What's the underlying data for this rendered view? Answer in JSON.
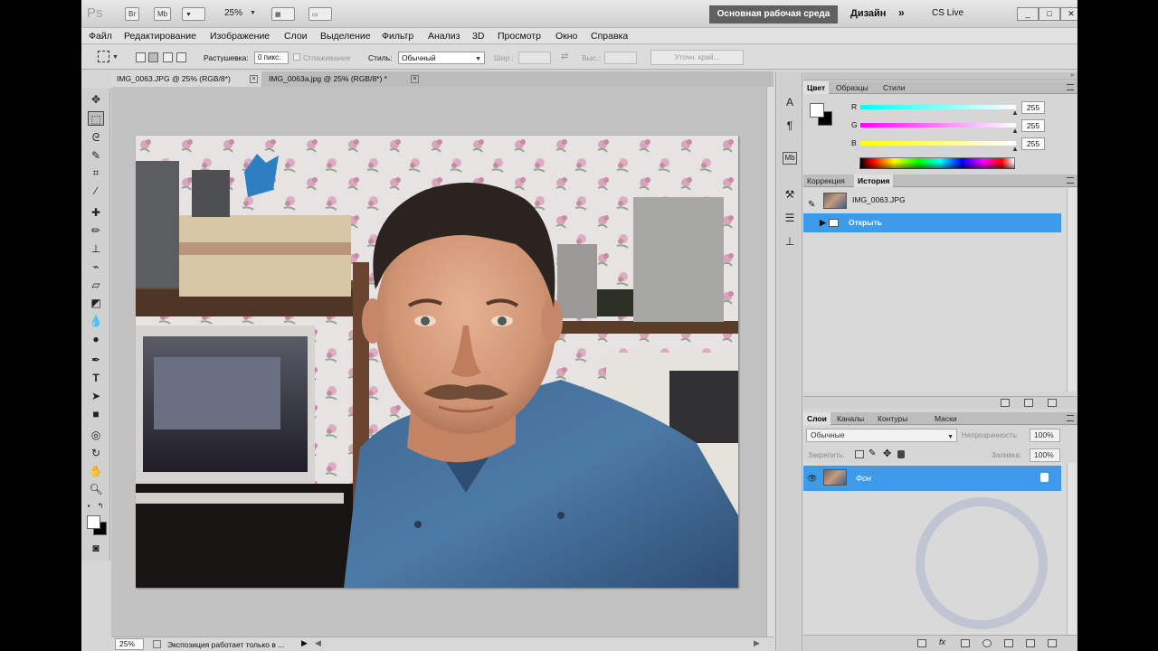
{
  "app": {
    "logo": "Ps",
    "bridge_label": "Br",
    "minibridge_label": "Mb",
    "zoom_top": "25%",
    "workspace_button": "Основная рабочая среда",
    "design_label": "Дизайн",
    "cslive_label": "CS Live"
  },
  "menu": [
    "Файл",
    "Редактирование",
    "Изображение",
    "Слои",
    "Выделение",
    "Фильтр",
    "Анализ",
    "3D",
    "Просмотр",
    "Окно",
    "Справка"
  ],
  "options": {
    "feather_label": "Растушевка:",
    "feather_value": "0 пикс.",
    "antialias_label": "Сглаживание",
    "style_label": "Стиль:",
    "style_value": "Обычный",
    "width_label": "Шир.:",
    "height_label": "Выс.:",
    "refine_edge_label": "Уточн. край..."
  },
  "documents": [
    {
      "title": "IMG_0063.JPG @ 25% (RGB/8*)",
      "close": "×"
    },
    {
      "title": "IMG_0063a.jpg @ 25% (RGB/8*) *",
      "close": "×"
    }
  ],
  "status": {
    "zoom": "25%",
    "text": "Экспозиция работает только в ..."
  },
  "color_panel": {
    "tabs": [
      "Цвет",
      "Образцы",
      "Стили"
    ],
    "channels": [
      {
        "label": "R",
        "value": "255",
        "color": "#33d6d6"
      },
      {
        "label": "G",
        "value": "255",
        "color": "#e62ee6"
      },
      {
        "label": "B",
        "value": "255",
        "color": "#e6e62e"
      }
    ]
  },
  "history_panel": {
    "tabs": [
      "Коррекция",
      "История"
    ],
    "snapshot": "IMG_0063.JPG",
    "items": [
      "Открыть"
    ]
  },
  "layers_panel": {
    "tabs": [
      "Слои",
      "Каналы",
      "Контуры",
      "Маски"
    ],
    "blend_mode": "Обычные",
    "opacity_label": "Непрозрачность:",
    "opacity_value": "100%",
    "lock_label": "Закрепить:",
    "fill_label": "Заливка:",
    "fill_value": "100%",
    "layers": [
      {
        "name": "Фон",
        "visible": true,
        "locked": true
      }
    ]
  },
  "colors": {
    "accent": "#3d9bea",
    "workspace": "#606060"
  }
}
